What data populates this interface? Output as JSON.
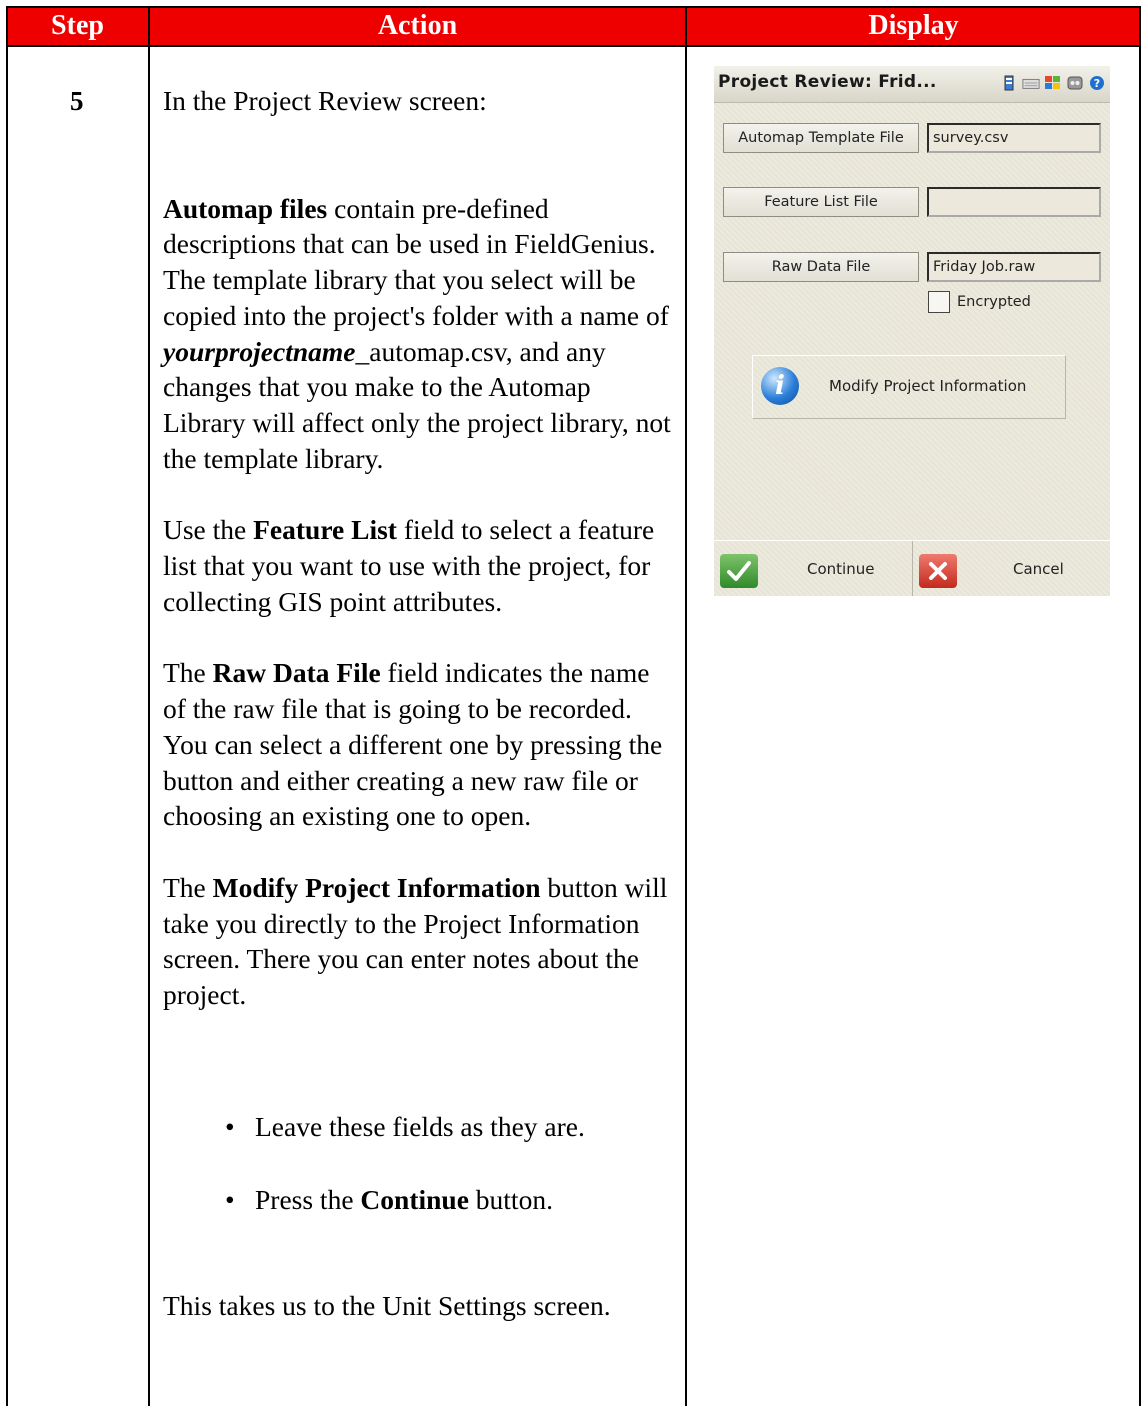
{
  "table": {
    "headers": {
      "step": "Step",
      "action": "Action",
      "display": "Display"
    },
    "step_number": "5"
  },
  "action": {
    "intro": "In the Project Review screen:",
    "automap": {
      "bold": "Automap files",
      "text1": " contain pre-defined descriptions that can be used in FieldGenius. The template library that you select will be copied into the project's folder with a name of ",
      "italic": "yourprojectname",
      "text2": "_automap.csv, and any changes that you make to the Automap Library will affect only the project library, not the template library."
    },
    "feature": {
      "pre": "Use the ",
      "bold": "Feature List",
      "post": " field to select a feature list that you want to use with the project, for collecting GIS point attributes."
    },
    "raw": {
      "pre": "The ",
      "bold": "Raw Data File",
      "post": " field indicates the name of the raw file that is going to be recorded. You can select a different one by pressing the button and either creating a new raw file or choosing an existing one to open."
    },
    "modify": {
      "pre": "The ",
      "bold": "Modify Project Information",
      "post": " button will take you directly to the Project Information screen. There you can enter notes about the project."
    },
    "bullets": {
      "b1": "Leave these fields as they are.",
      "b2_pre": "Press the ",
      "b2_bold": "Continue",
      "b2_post": " button."
    },
    "closing": "This takes us to the Unit Settings screen."
  },
  "device": {
    "title": "Project Review: Frid...",
    "automap_button": "Automap Template File",
    "automap_value": "survey.csv",
    "feature_button": "Feature List File",
    "feature_value": "",
    "raw_button": "Raw Data File",
    "raw_value": "Friday Job.raw",
    "encrypted_label": "Encrypted",
    "modify_button": "Modify Project Information",
    "continue_label": "Continue",
    "cancel_label": "Cancel"
  }
}
